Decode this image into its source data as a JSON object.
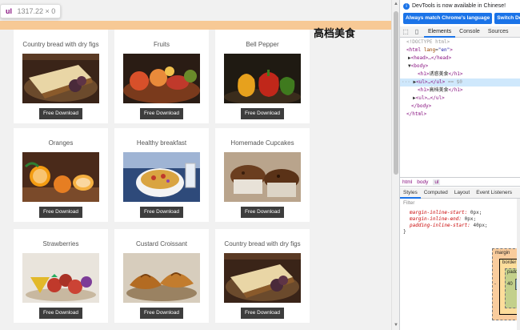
{
  "inspector": {
    "tag": "ul",
    "dimensions": "1317.22 × 0"
  },
  "page": {
    "heading": "高档美食",
    "cards": [
      {
        "title": "Country bread with dry figs",
        "image": "bread",
        "button": "Free Download"
      },
      {
        "title": "Fruits",
        "image": "fruits",
        "button": "Free Download"
      },
      {
        "title": "Bell Pepper",
        "image": "pepper",
        "button": "Free Download"
      },
      {
        "title": "Oranges",
        "image": "oranges",
        "button": "Free Download"
      },
      {
        "title": "Healthy breakfast",
        "image": "breakfast",
        "button": "Free Download"
      },
      {
        "title": "Homemade Cupcakes",
        "image": "cupcakes",
        "button": "Free Download"
      },
      {
        "title": "Strawberries",
        "image": "strawberries",
        "button": "Free Download"
      },
      {
        "title": "Custard Croissant",
        "image": "croissant",
        "button": "Free Download"
      },
      {
        "title": "Country bread with dry figs",
        "image": "bread",
        "button": "Free Download"
      }
    ]
  },
  "devtools": {
    "notice": "DevTools is now available in Chinese!",
    "match_button": "Always match Chrome's language",
    "switch_button": "Switch DevT",
    "tabs": [
      "Elements",
      "Console",
      "Sources"
    ],
    "dom": {
      "doctype": "<!DOCTYPE html>",
      "html_open_tag": "html",
      "lang_attr": "lang",
      "lang_value": "\"en\"",
      "head": "<head>…</head>",
      "body_open": "<body>",
      "h1_first": "<h1>",
      "h1_first_text": "诱惑美食",
      "h1_first_close": "</h1>",
      "ul_selected": "<ul>…</ul>",
      "selected_marker": "== $0",
      "h1_second": "<h1>",
      "h1_second_text": "高档美食",
      "h1_second_close": "</h1>",
      "ul_second": "<ul>…</ul>",
      "body_close": "</body>",
      "html_close": "</html>"
    },
    "breadcrumbs": [
      "html",
      "body",
      "ul"
    ],
    "subtabs": [
      "Styles",
      "Computed",
      "Layout",
      "Event Listeners"
    ],
    "filter_placeholder": "Filter",
    "css_lines": [
      {
        "prop": "margin-inline-start:",
        "value": "0px;"
      },
      {
        "prop": "margin-inline-end:",
        "value": "0px;"
      },
      {
        "prop": "padding-inline-start:",
        "value": "40px;"
      }
    ],
    "css_close": "}",
    "boxmodel": {
      "margin_label": "margin",
      "border_label": "border",
      "padding_label": "paddi",
      "dash": "-",
      "padding_value": "40"
    }
  }
}
